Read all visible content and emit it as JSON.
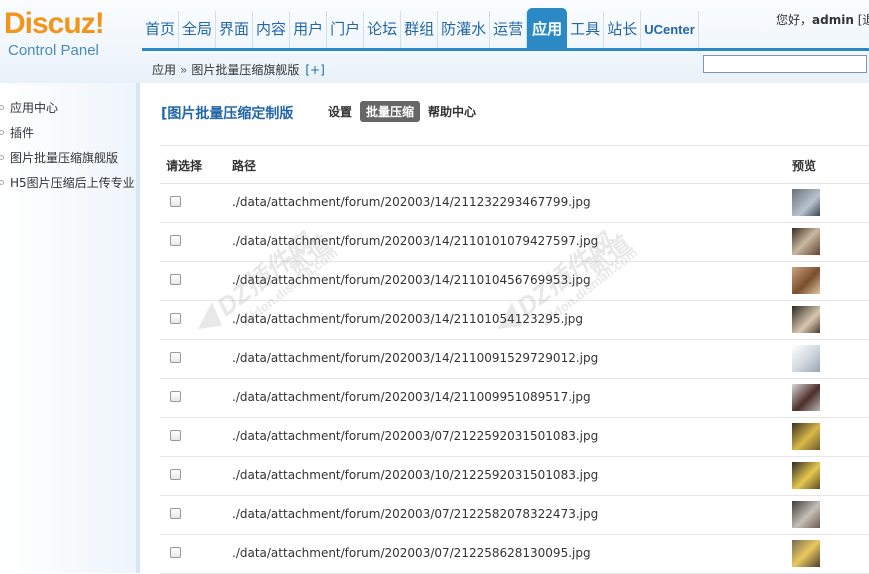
{
  "header": {
    "logo_brand": "Discuz",
    "logo_excl": "!",
    "logo_sub": "Control Panel",
    "nav": [
      "首页",
      "全局",
      "界面",
      "内容",
      "用户",
      "门户",
      "论坛",
      "群组",
      "防灌水",
      "运营",
      "应用",
      "工具",
      "站长",
      "UCenter"
    ],
    "active_nav": "应用",
    "greeting_prefix": "您好，",
    "greeting_user": "admin",
    "greeting_suffix": "[退"
  },
  "breadcrumb": {
    "root": "应用",
    "separator": "»",
    "current": "图片批量压缩旗舰版",
    "add": "[+]"
  },
  "search": {
    "value": ""
  },
  "sidebar": {
    "items": [
      "应用中心",
      "插件",
      "图片批量压缩旗舰版",
      "H5图片压缩后上传专业"
    ]
  },
  "main": {
    "plugin_title": "[图片批量压缩定制版",
    "tabs": [
      "设置",
      "批量压缩",
      "帮助中心"
    ],
    "active_tab": "批量压缩",
    "columns": {
      "select": "请选择",
      "path": "路径",
      "preview": "预览"
    },
    "rows": [
      {
        "path": "./data/attachment/forum/202003/14/211232293467799.jpg"
      },
      {
        "path": "./data/attachment/forum/202003/14/211010107942759​7.jpg"
      },
      {
        "path": "./data/attachment/forum/202003/14/211010456769953.jpg"
      },
      {
        "path": "./data/attachment/forum/202003/14/21101054123295.jpg"
      },
      {
        "path": "./data/attachment/forum/202003/14/211009152972901​2.jpg"
      },
      {
        "path": "./data/attachment/forum/202003/14/211009951089517.jpg"
      },
      {
        "path": "./data/attachment/forum/202003/07/2122592031501083.jpg"
      },
      {
        "path": "./data/attachment/forum/202003/10/2122592031501083.jpg"
      },
      {
        "path": "./data/attachment/forum/202003/07/2122582078322473.jpg"
      },
      {
        "path": "./data/attachment/forum/202003/07/212258628130095.jpg"
      }
    ]
  },
  "watermark": {
    "text": "DZ插件网",
    "subtext": "addon.dismall.com",
    "brand": "贰道"
  },
  "colors": {
    "accent": "#2b8ac5",
    "nav_text": "#2366a8",
    "logo_orange": "#f0961c"
  }
}
